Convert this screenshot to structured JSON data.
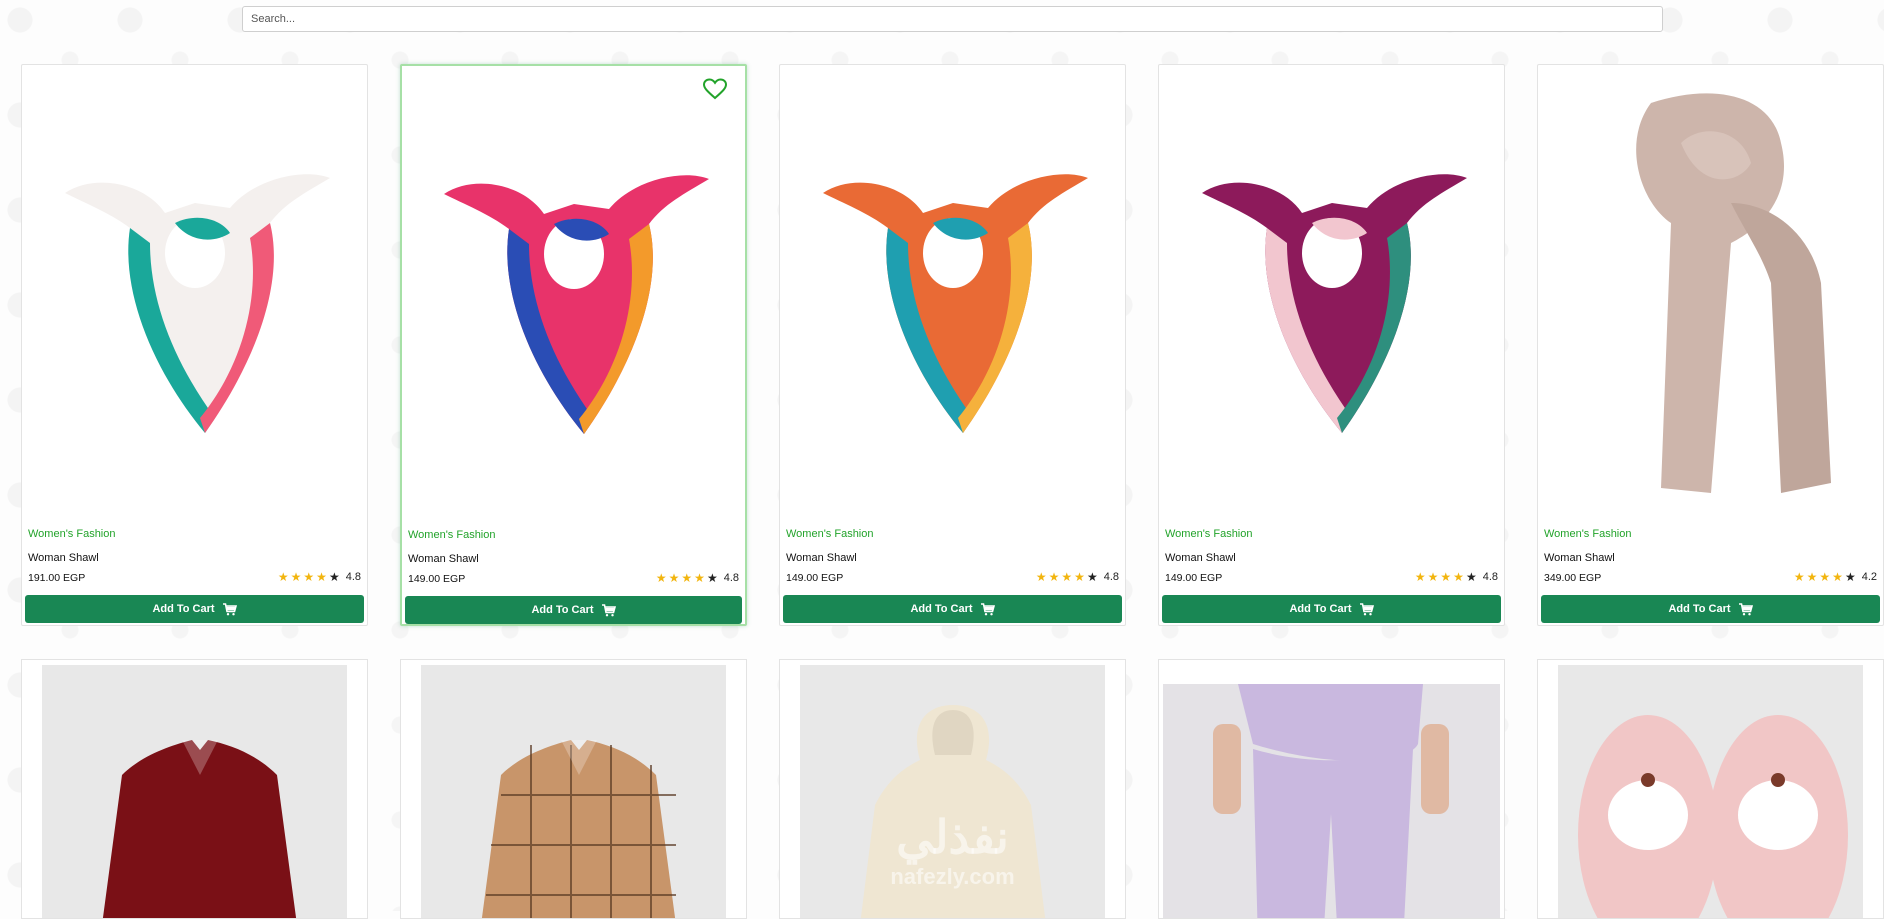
{
  "search": {
    "placeholder": "Search..."
  },
  "products": [
    {
      "category": "Women's Fashion",
      "name": "Woman Shawl",
      "price": "191.00 EGP",
      "rating": "4.8",
      "stars": 4,
      "button": "Add To Cart",
      "colors": [
        "#f4f0ee",
        "#1aa89a",
        "#f05a78"
      ]
    },
    {
      "category": "Women's Fashion",
      "name": "Woman Shawl",
      "price": "149.00 EGP",
      "rating": "4.8",
      "stars": 4,
      "button": "Add To Cart",
      "colors": [
        "#e8336a",
        "#2a4db5",
        "#f39a2b"
      ]
    },
    {
      "category": "Women's Fashion",
      "name": "Woman Shawl",
      "price": "149.00 EGP",
      "rating": "4.8",
      "stars": 4,
      "button": "Add To Cart",
      "colors": [
        "#e96a35",
        "#1f9fb0",
        "#f5b13c"
      ]
    },
    {
      "category": "Women's Fashion",
      "name": "Woman Shawl",
      "price": "149.00 EGP",
      "rating": "4.8",
      "stars": 4,
      "button": "Add To Cart",
      "colors": [
        "#8d1a5b",
        "#f2c6cf",
        "#2e8f7e"
      ]
    },
    {
      "category": "Women's Fashion",
      "name": "Woman Shawl",
      "price": "349.00 EGP",
      "rating": "4.2",
      "stars": 4,
      "button": "Add To Cart",
      "colors": [
        "#cdb5ab",
        "#bfa69b",
        "#d8c3ba"
      ]
    }
  ],
  "row2": [
    {
      "color": "#7a1016",
      "bg": "#e8e8e8"
    },
    {
      "color": "#c8956a",
      "bg": "#e8e8e8"
    },
    {
      "color": "#efe6d2",
      "bg": "#e8e8e8"
    },
    {
      "color": "#c9b8df",
      "bg": "#e4e2e6"
    },
    {
      "color": "#f1c6c6",
      "bg": "#e8e8e8"
    }
  ],
  "watermark": {
    "arabic": "نفذلي",
    "latin": "nafezly.com"
  },
  "accent": "#198754",
  "category_color": "#22a32a",
  "icons": {
    "heart": "heart-icon",
    "cart": "cart-icon",
    "star": "star-icon"
  }
}
